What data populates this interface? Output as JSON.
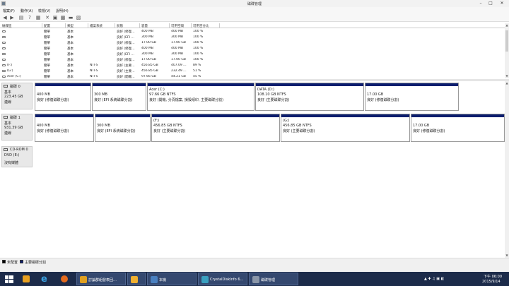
{
  "window": {
    "title": "磁碟管理",
    "minimize": "–",
    "maximize": "□",
    "close": "✕"
  },
  "menu": [
    "檔案(F)",
    "動作(A)",
    "檢視(V)",
    "說明(H)"
  ],
  "toolbar": {
    "icons": [
      "back-icon",
      "forward-icon",
      "volume-list-icon",
      "help-icon",
      "properties-icon",
      "delete-icon",
      "open-icon",
      "explore-icon",
      "disk-icon"
    ]
  },
  "volume_list": {
    "headers": [
      "磁碟區",
      "配置",
      "類型",
      "檔案系統",
      "狀態",
      "容量",
      "可用空間",
      "可用百分比"
    ],
    "rows": [
      [
        "",
        "簡單",
        "基本",
        "",
        "良好 (修復…",
        "400 MB",
        "400 MB",
        "100 %"
      ],
      [
        "",
        "簡單",
        "基本",
        "",
        "良好 (EFI …",
        "300 MB",
        "300 MB",
        "100 %"
      ],
      [
        "",
        "簡單",
        "基本",
        "",
        "良好 (修復…",
        "17.00 GB",
        "17.00 GB",
        "100 %"
      ],
      [
        "",
        "簡單",
        "基本",
        "",
        "良好 (修復…",
        "400 MB",
        "400 MB",
        "100 %"
      ],
      [
        "",
        "簡單",
        "基本",
        "",
        "良好 (EFI …",
        "300 MB",
        "300 MB",
        "100 %"
      ],
      [
        "",
        "簡單",
        "基本",
        "",
        "良好 (修復…",
        "17.00 GB",
        "17.00 GB",
        "100 %"
      ],
      [
        "(F:)",
        "簡單",
        "基本",
        "NTFS",
        "良好 (主要…",
        "456.85 GB",
        "407.09 …",
        "89 %"
      ],
      [
        "(G:)",
        "簡單",
        "基本",
        "NTFS",
        "良好 (主要…",
        "456.85 GB",
        "232.49 …",
        "51 %"
      ],
      [
        "Acer (C:)",
        "簡單",
        "基本",
        "NTFS",
        "良好 (開機…",
        "97.66 GB",
        "44.21 GB",
        "45 %"
      ]
    ]
  },
  "disks": [
    {
      "name": "磁碟 0",
      "type": "基本",
      "size": "223.45 GB",
      "status": "連線",
      "partitions": [
        {
          "l1": "",
          "l2": "400 MB",
          "l3": "良好 (修復磁碟分割)"
        },
        {
          "l1": "",
          "l2": "300 MB",
          "l3": "良好 (EFI 系統磁碟分割)"
        },
        {
          "l1": "Acer (C:)",
          "l2": "97.66 GB NTFS",
          "l3": "良好 (開機, 分頁檔案, 損毀傾印, 主要磁碟分割)"
        },
        {
          "l1": "DATA (D:)",
          "l2": "108.10 GB NTFS",
          "l3": "良好 (主要磁碟分割)"
        },
        {
          "l1": "",
          "l2": "17.00 GB",
          "l3": "良好 (修復磁碟分割)"
        }
      ]
    },
    {
      "name": "磁碟 1",
      "type": "基本",
      "size": "931.39 GB",
      "status": "連線",
      "partitions": [
        {
          "l1": "",
          "l2": "400 MB",
          "l3": "良好 (修復磁碟分割)"
        },
        {
          "l1": "",
          "l2": "300 MB",
          "l3": "良好 (EFI 系統磁碟分割)"
        },
        {
          "l1": "(F:)",
          "l2": "456.85 GB NTFS",
          "l3": "良好 (主要磁碟分割)"
        },
        {
          "l1": "(G:)",
          "l2": "456.85 GB NTFS",
          "l3": "良好 (主要磁碟分割)"
        },
        {
          "l1": "",
          "l2": "17.00 GB",
          "l3": "良好 (修復磁碟分割)"
        }
      ]
    },
    {
      "name": "CD-ROM 0",
      "type": "DVD (E:)",
      "size": "",
      "status": "沒有媒體",
      "partitions": []
    }
  ],
  "legend": [
    {
      "label": "未配置",
      "color": "#000000"
    },
    {
      "label": "主要磁碟分割",
      "color": "#0b1d6e"
    }
  ],
  "taskbar": {
    "buttons": [
      {
        "label": "討論群組發表回…",
        "icon": "chrome-icon",
        "color": "#e0a020"
      },
      {
        "label": "",
        "icon": "game-icon",
        "color": "#f0b030"
      },
      {
        "label": "本機",
        "icon": "computer-icon",
        "color": "#4a80c0"
      },
      {
        "label": "CrystalDiskInfo 6…",
        "icon": "crystaldiskinfo-icon",
        "color": "#3aa0c0"
      },
      {
        "label": "磁碟管理",
        "icon": "disk-management-icon",
        "color": "#8a96a8"
      }
    ],
    "time": "下午 06:00",
    "date": "2015/9/14"
  },
  "colors": {
    "primary_partition": "#0b1d6e",
    "taskbar": "#1c2b4a"
  }
}
